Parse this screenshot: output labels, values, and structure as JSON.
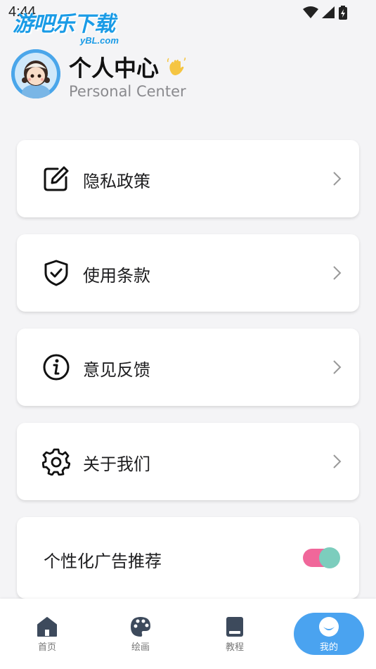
{
  "status_bar": {
    "time": "4:44"
  },
  "watermark": {
    "text": "游吧乐下载",
    "sub": "yBL.com"
  },
  "header": {
    "title": "个人中心",
    "subtitle": "Personal Center"
  },
  "menu": [
    {
      "label": "隐私政策",
      "icon": "edit-icon"
    },
    {
      "label": "使用条款",
      "icon": "shield-check-icon"
    },
    {
      "label": "意见反馈",
      "icon": "info-icon"
    },
    {
      "label": "关于我们",
      "icon": "gear-icon"
    }
  ],
  "ad_setting": {
    "label": "个性化广告推荐",
    "enabled": true
  },
  "nav": [
    {
      "label": "首页",
      "icon": "home-icon"
    },
    {
      "label": "绘画",
      "icon": "palette-icon"
    },
    {
      "label": "教程",
      "icon": "book-icon"
    },
    {
      "label": "我的",
      "icon": "profile-icon",
      "active": true
    }
  ],
  "colors": {
    "accent": "#4aa3f0",
    "toggle_track": "#f0679a",
    "toggle_knob": "#7ccdbd",
    "watermark": "#1a9be6"
  }
}
